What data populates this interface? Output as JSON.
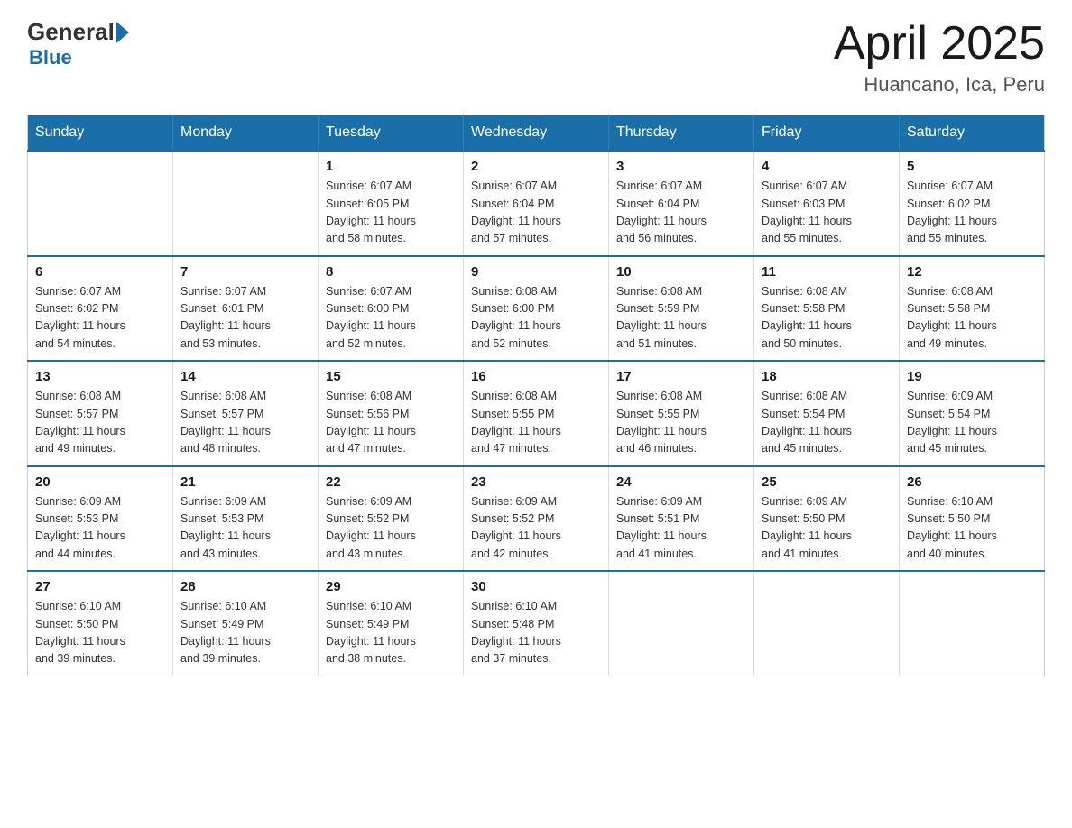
{
  "header": {
    "logo": {
      "general": "General",
      "blue": "Blue"
    },
    "title": "April 2025",
    "subtitle": "Huancano, Ica, Peru"
  },
  "calendar": {
    "days_of_week": [
      "Sunday",
      "Monday",
      "Tuesday",
      "Wednesday",
      "Thursday",
      "Friday",
      "Saturday"
    ],
    "weeks": [
      [
        {
          "day": "",
          "info": ""
        },
        {
          "day": "",
          "info": ""
        },
        {
          "day": "1",
          "info": "Sunrise: 6:07 AM\nSunset: 6:05 PM\nDaylight: 11 hours\nand 58 minutes."
        },
        {
          "day": "2",
          "info": "Sunrise: 6:07 AM\nSunset: 6:04 PM\nDaylight: 11 hours\nand 57 minutes."
        },
        {
          "day": "3",
          "info": "Sunrise: 6:07 AM\nSunset: 6:04 PM\nDaylight: 11 hours\nand 56 minutes."
        },
        {
          "day": "4",
          "info": "Sunrise: 6:07 AM\nSunset: 6:03 PM\nDaylight: 11 hours\nand 55 minutes."
        },
        {
          "day": "5",
          "info": "Sunrise: 6:07 AM\nSunset: 6:02 PM\nDaylight: 11 hours\nand 55 minutes."
        }
      ],
      [
        {
          "day": "6",
          "info": "Sunrise: 6:07 AM\nSunset: 6:02 PM\nDaylight: 11 hours\nand 54 minutes."
        },
        {
          "day": "7",
          "info": "Sunrise: 6:07 AM\nSunset: 6:01 PM\nDaylight: 11 hours\nand 53 minutes."
        },
        {
          "day": "8",
          "info": "Sunrise: 6:07 AM\nSunset: 6:00 PM\nDaylight: 11 hours\nand 52 minutes."
        },
        {
          "day": "9",
          "info": "Sunrise: 6:08 AM\nSunset: 6:00 PM\nDaylight: 11 hours\nand 52 minutes."
        },
        {
          "day": "10",
          "info": "Sunrise: 6:08 AM\nSunset: 5:59 PM\nDaylight: 11 hours\nand 51 minutes."
        },
        {
          "day": "11",
          "info": "Sunrise: 6:08 AM\nSunset: 5:58 PM\nDaylight: 11 hours\nand 50 minutes."
        },
        {
          "day": "12",
          "info": "Sunrise: 6:08 AM\nSunset: 5:58 PM\nDaylight: 11 hours\nand 49 minutes."
        }
      ],
      [
        {
          "day": "13",
          "info": "Sunrise: 6:08 AM\nSunset: 5:57 PM\nDaylight: 11 hours\nand 49 minutes."
        },
        {
          "day": "14",
          "info": "Sunrise: 6:08 AM\nSunset: 5:57 PM\nDaylight: 11 hours\nand 48 minutes."
        },
        {
          "day": "15",
          "info": "Sunrise: 6:08 AM\nSunset: 5:56 PM\nDaylight: 11 hours\nand 47 minutes."
        },
        {
          "day": "16",
          "info": "Sunrise: 6:08 AM\nSunset: 5:55 PM\nDaylight: 11 hours\nand 47 minutes."
        },
        {
          "day": "17",
          "info": "Sunrise: 6:08 AM\nSunset: 5:55 PM\nDaylight: 11 hours\nand 46 minutes."
        },
        {
          "day": "18",
          "info": "Sunrise: 6:08 AM\nSunset: 5:54 PM\nDaylight: 11 hours\nand 45 minutes."
        },
        {
          "day": "19",
          "info": "Sunrise: 6:09 AM\nSunset: 5:54 PM\nDaylight: 11 hours\nand 45 minutes."
        }
      ],
      [
        {
          "day": "20",
          "info": "Sunrise: 6:09 AM\nSunset: 5:53 PM\nDaylight: 11 hours\nand 44 minutes."
        },
        {
          "day": "21",
          "info": "Sunrise: 6:09 AM\nSunset: 5:53 PM\nDaylight: 11 hours\nand 43 minutes."
        },
        {
          "day": "22",
          "info": "Sunrise: 6:09 AM\nSunset: 5:52 PM\nDaylight: 11 hours\nand 43 minutes."
        },
        {
          "day": "23",
          "info": "Sunrise: 6:09 AM\nSunset: 5:52 PM\nDaylight: 11 hours\nand 42 minutes."
        },
        {
          "day": "24",
          "info": "Sunrise: 6:09 AM\nSunset: 5:51 PM\nDaylight: 11 hours\nand 41 minutes."
        },
        {
          "day": "25",
          "info": "Sunrise: 6:09 AM\nSunset: 5:50 PM\nDaylight: 11 hours\nand 41 minutes."
        },
        {
          "day": "26",
          "info": "Sunrise: 6:10 AM\nSunset: 5:50 PM\nDaylight: 11 hours\nand 40 minutes."
        }
      ],
      [
        {
          "day": "27",
          "info": "Sunrise: 6:10 AM\nSunset: 5:50 PM\nDaylight: 11 hours\nand 39 minutes."
        },
        {
          "day": "28",
          "info": "Sunrise: 6:10 AM\nSunset: 5:49 PM\nDaylight: 11 hours\nand 39 minutes."
        },
        {
          "day": "29",
          "info": "Sunrise: 6:10 AM\nSunset: 5:49 PM\nDaylight: 11 hours\nand 38 minutes."
        },
        {
          "day": "30",
          "info": "Sunrise: 6:10 AM\nSunset: 5:48 PM\nDaylight: 11 hours\nand 37 minutes."
        },
        {
          "day": "",
          "info": ""
        },
        {
          "day": "",
          "info": ""
        },
        {
          "day": "",
          "info": ""
        }
      ]
    ]
  }
}
